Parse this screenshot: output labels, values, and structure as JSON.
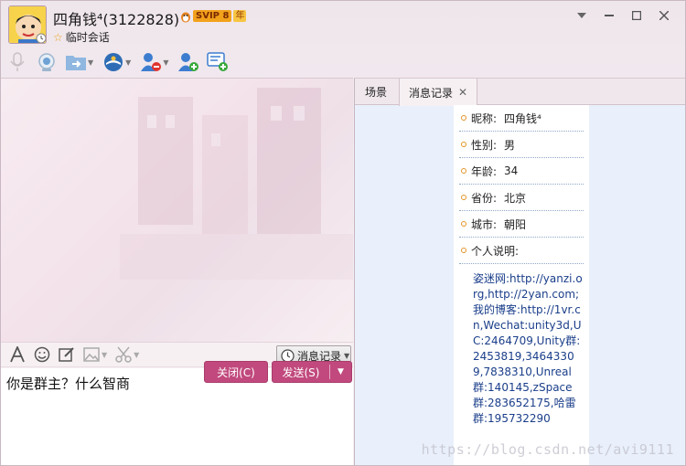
{
  "window": {
    "contact_name": "四角钱⁴(3122828)",
    "svip_badge": "SVIP 8",
    "svip_year": "年",
    "session_type": "临时会话",
    "controls": {
      "dropdown": "▼",
      "minimize": "—",
      "maximize": "☐",
      "close": "✕"
    }
  },
  "toolbar": {
    "icons": [
      "microphone-icon",
      "video-camera-icon",
      "file-transfer-icon",
      "remote-assist-icon",
      "remove-contact-icon",
      "add-contact-icon",
      "message-plus-icon"
    ]
  },
  "chat": {
    "history_label": "消息记录",
    "input_text": "你是群主？什么智商",
    "close_label": "关闭(C)",
    "send_label": "发送(S)"
  },
  "right": {
    "tabs": [
      {
        "label": "场景"
      },
      {
        "label": "消息记录"
      }
    ],
    "profile": [
      {
        "label": "昵称:",
        "value": "四角钱⁴"
      },
      {
        "label": "性别:",
        "value": "男"
      },
      {
        "label": "年龄:",
        "value": "34"
      },
      {
        "label": "省份:",
        "value": "北京"
      },
      {
        "label": "城市:",
        "value": "朝阳"
      },
      {
        "label": "个人说明:",
        "value": ""
      }
    ],
    "description": "姿迷网:http://yanzi.org,http://2yan.com;我的博客:http://1vr.cn,Wechat:unity3d,UC:2464709,Unity群:2453819,34643309,7838310,Unreal群:140145,zSpace群:283652175,哈雷群:195732290"
  },
  "watermark": "https://blog.csdn.net/avi9111",
  "colors": {
    "accent": "#c1497d",
    "link_blue": "#1a3e8a",
    "bullet": "#e3952a"
  }
}
